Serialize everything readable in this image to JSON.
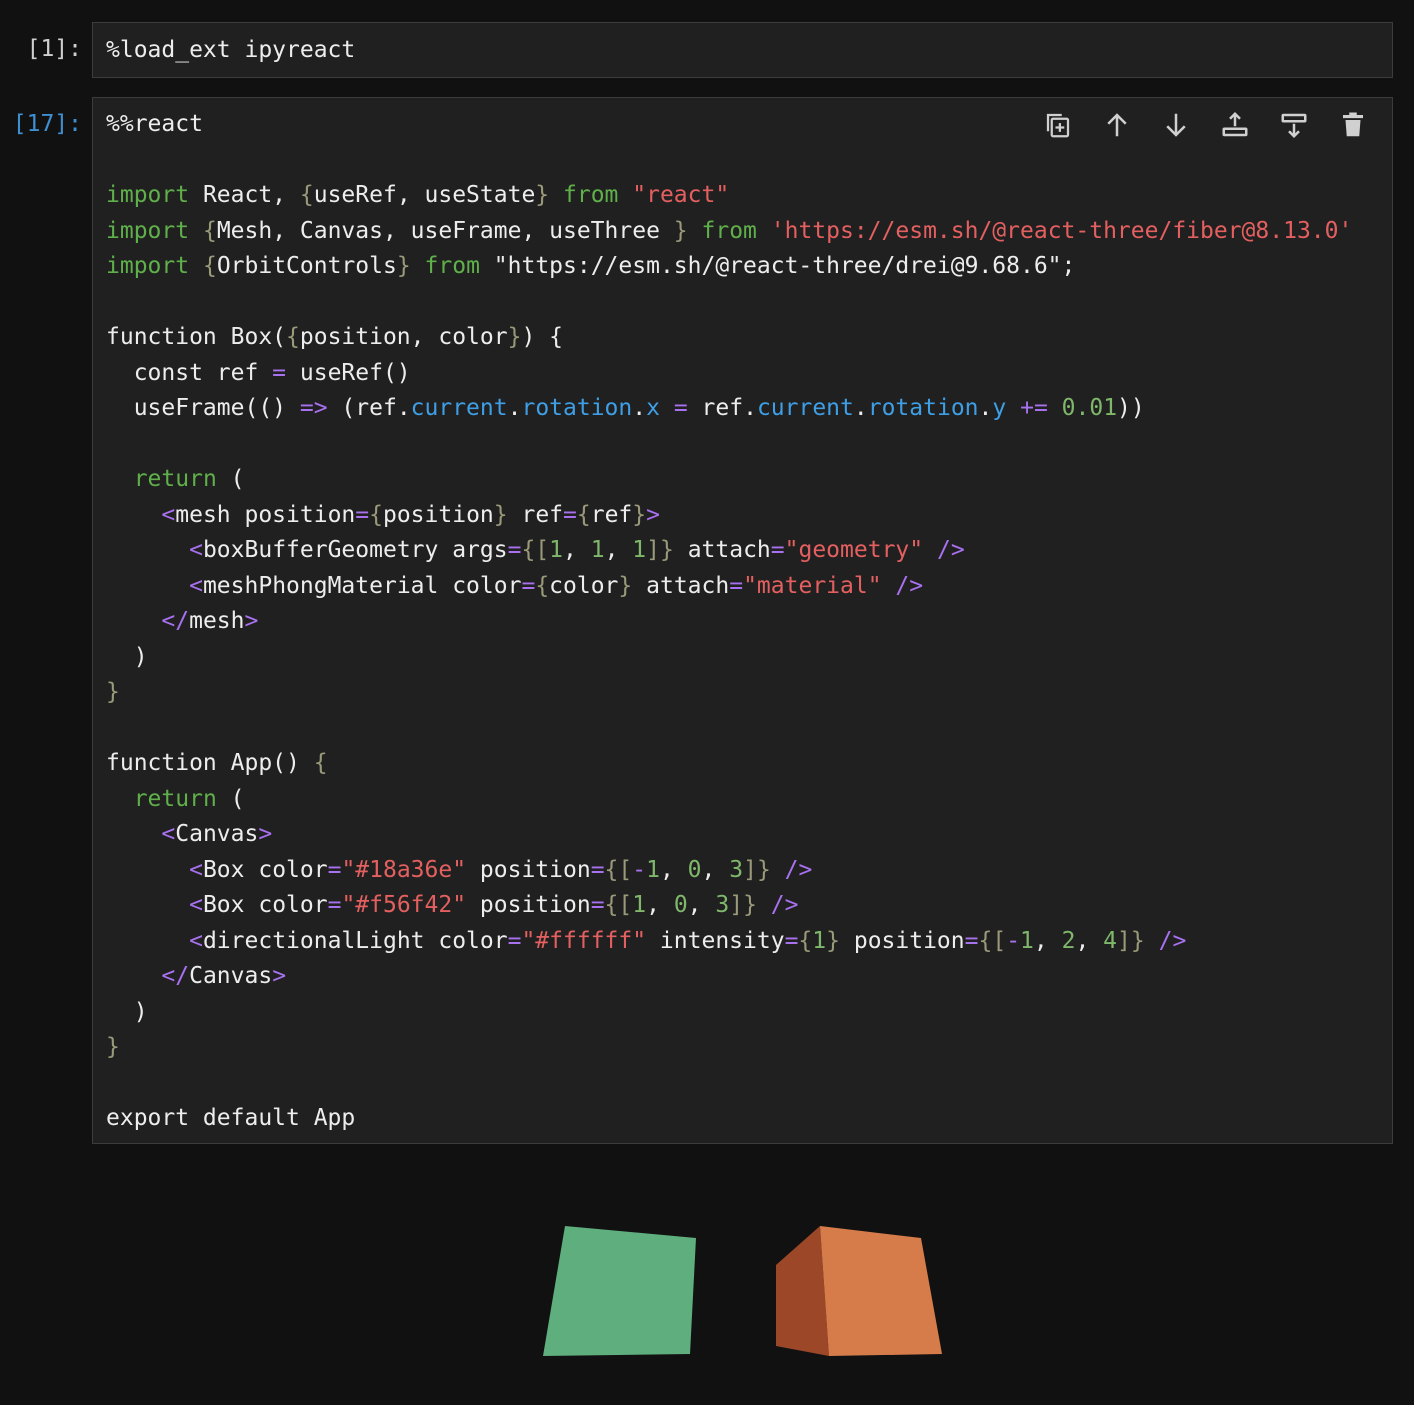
{
  "cells": [
    {
      "prompt": "[1]:",
      "lines": [
        [
          [
            "txt",
            "%load_ext ipyreact"
          ]
        ]
      ]
    },
    {
      "prompt": "[17]:",
      "lines": [
        [
          [
            "txt",
            "%%react"
          ]
        ],
        [],
        [
          [
            "kw",
            "import"
          ],
          [
            "txt",
            " React, "
          ],
          [
            "pun",
            "{"
          ],
          [
            "txt",
            "useRef, useState"
          ],
          [
            "pun",
            "}"
          ],
          [
            "txt",
            " "
          ],
          [
            "kw",
            "from"
          ],
          [
            "txt",
            " "
          ],
          [
            "str",
            "\"react\""
          ]
        ],
        [
          [
            "kw",
            "import"
          ],
          [
            "txt",
            " "
          ],
          [
            "pun",
            "{"
          ],
          [
            "txt",
            "Mesh, Canvas, useFrame, useThree "
          ],
          [
            "pun",
            "}"
          ],
          [
            "txt",
            " "
          ],
          [
            "kw",
            "from"
          ],
          [
            "txt",
            " "
          ],
          [
            "str",
            "'https://esm.sh/@react-three/fiber@8.13.0'"
          ]
        ],
        [
          [
            "kw",
            "import"
          ],
          [
            "txt",
            " "
          ],
          [
            "pun",
            "{"
          ],
          [
            "txt",
            "OrbitControls"
          ],
          [
            "pun",
            "}"
          ],
          [
            "txt",
            " "
          ],
          [
            "kw",
            "from"
          ],
          [
            "txt",
            " \"https://esm.sh/@react-three/drei@9.68.6\";"
          ]
        ],
        [],
        [
          [
            "txt",
            "function Box("
          ],
          [
            "pun",
            "{"
          ],
          [
            "txt",
            "position, color"
          ],
          [
            "pun",
            "}"
          ],
          [
            "txt",
            ") {"
          ]
        ],
        [
          [
            "txt",
            "  const ref "
          ],
          [
            "op",
            "="
          ],
          [
            "txt",
            " useRef()"
          ]
        ],
        [
          [
            "txt",
            "  useFrame(() "
          ],
          [
            "op",
            "=>"
          ],
          [
            "txt",
            " (ref."
          ],
          [
            "prop",
            "current"
          ],
          [
            "txt",
            "."
          ],
          [
            "prop",
            "rotation"
          ],
          [
            "txt",
            "."
          ],
          [
            "prop",
            "x"
          ],
          [
            "txt",
            " "
          ],
          [
            "op",
            "="
          ],
          [
            "txt",
            " ref."
          ],
          [
            "prop",
            "current"
          ],
          [
            "txt",
            "."
          ],
          [
            "prop",
            "rotation"
          ],
          [
            "txt",
            "."
          ],
          [
            "prop",
            "y"
          ],
          [
            "txt",
            " "
          ],
          [
            "op",
            "+="
          ],
          [
            "txt",
            " "
          ],
          [
            "num",
            "0.01"
          ],
          [
            "txt",
            "))"
          ]
        ],
        [],
        [
          [
            "txt",
            "  "
          ],
          [
            "kw",
            "return"
          ],
          [
            "txt",
            " ("
          ]
        ],
        [
          [
            "txt",
            "    "
          ],
          [
            "tag",
            "<"
          ],
          [
            "txt",
            "mesh position"
          ],
          [
            "op",
            "="
          ],
          [
            "pun",
            "{"
          ],
          [
            "txt",
            "position"
          ],
          [
            "pun",
            "}"
          ],
          [
            "txt",
            " ref"
          ],
          [
            "op",
            "="
          ],
          [
            "pun",
            "{"
          ],
          [
            "txt",
            "ref"
          ],
          [
            "pun",
            "}"
          ],
          [
            "tag",
            ">"
          ]
        ],
        [
          [
            "txt",
            "      "
          ],
          [
            "tag",
            "<"
          ],
          [
            "txt",
            "boxBufferGeometry args"
          ],
          [
            "op",
            "="
          ],
          [
            "pun",
            "{["
          ],
          [
            "num",
            "1"
          ],
          [
            "txt",
            ", "
          ],
          [
            "num",
            "1"
          ],
          [
            "txt",
            ", "
          ],
          [
            "num",
            "1"
          ],
          [
            "pun",
            "]}"
          ],
          [
            "txt",
            " attach"
          ],
          [
            "op",
            "="
          ],
          [
            "str",
            "\"geometry\""
          ],
          [
            "txt",
            " "
          ],
          [
            "tag",
            "/>"
          ]
        ],
        [
          [
            "txt",
            "      "
          ],
          [
            "tag",
            "<"
          ],
          [
            "txt",
            "meshPhongMaterial color"
          ],
          [
            "op",
            "="
          ],
          [
            "pun",
            "{"
          ],
          [
            "txt",
            "color"
          ],
          [
            "pun",
            "}"
          ],
          [
            "txt",
            " attach"
          ],
          [
            "op",
            "="
          ],
          [
            "str",
            "\"material\""
          ],
          [
            "txt",
            " "
          ],
          [
            "tag",
            "/>"
          ]
        ],
        [
          [
            "txt",
            "    "
          ],
          [
            "tag",
            "</"
          ],
          [
            "txt",
            "mesh"
          ],
          [
            "tag",
            ">"
          ]
        ],
        [
          [
            "txt",
            "  )"
          ]
        ],
        [
          [
            "pun",
            "}"
          ]
        ],
        [],
        [
          [
            "txt",
            "function App() "
          ],
          [
            "pun",
            "{"
          ]
        ],
        [
          [
            "txt",
            "  "
          ],
          [
            "kw",
            "return"
          ],
          [
            "txt",
            " ("
          ]
        ],
        [
          [
            "txt",
            "    "
          ],
          [
            "tag",
            "<"
          ],
          [
            "txt",
            "Canvas"
          ],
          [
            "tag",
            ">"
          ]
        ],
        [
          [
            "txt",
            "      "
          ],
          [
            "tag",
            "<"
          ],
          [
            "txt",
            "Box color"
          ],
          [
            "op",
            "="
          ],
          [
            "str",
            "\"#18a36e\""
          ],
          [
            "txt",
            " position"
          ],
          [
            "op",
            "="
          ],
          [
            "pun",
            "{["
          ],
          [
            "op",
            "-"
          ],
          [
            "num",
            "1"
          ],
          [
            "txt",
            ", "
          ],
          [
            "num",
            "0"
          ],
          [
            "txt",
            ", "
          ],
          [
            "num",
            "3"
          ],
          [
            "pun",
            "]}"
          ],
          [
            "txt",
            " "
          ],
          [
            "tag",
            "/>"
          ]
        ],
        [
          [
            "txt",
            "      "
          ],
          [
            "tag",
            "<"
          ],
          [
            "txt",
            "Box color"
          ],
          [
            "op",
            "="
          ],
          [
            "str",
            "\"#f56f42\""
          ],
          [
            "txt",
            " position"
          ],
          [
            "op",
            "="
          ],
          [
            "pun",
            "{["
          ],
          [
            "num",
            "1"
          ],
          [
            "txt",
            ", "
          ],
          [
            "num",
            "0"
          ],
          [
            "txt",
            ", "
          ],
          [
            "num",
            "3"
          ],
          [
            "pun",
            "]}"
          ],
          [
            "txt",
            " "
          ],
          [
            "tag",
            "/>"
          ]
        ],
        [
          [
            "txt",
            "      "
          ],
          [
            "tag",
            "<"
          ],
          [
            "txt",
            "directionalLight color"
          ],
          [
            "op",
            "="
          ],
          [
            "str",
            "\"#ffffff\""
          ],
          [
            "txt",
            " intensity"
          ],
          [
            "op",
            "="
          ],
          [
            "pun",
            "{"
          ],
          [
            "num",
            "1"
          ],
          [
            "pun",
            "}"
          ],
          [
            "txt",
            " position"
          ],
          [
            "op",
            "="
          ],
          [
            "pun",
            "{["
          ],
          [
            "op",
            "-"
          ],
          [
            "num",
            "1"
          ],
          [
            "txt",
            ", "
          ],
          [
            "num",
            "2"
          ],
          [
            "txt",
            ", "
          ],
          [
            "num",
            "4"
          ],
          [
            "pun",
            "]}"
          ],
          [
            "txt",
            " "
          ],
          [
            "tag",
            "/>"
          ]
        ],
        [
          [
            "txt",
            "    "
          ],
          [
            "tag",
            "</"
          ],
          [
            "txt",
            "Canvas"
          ],
          [
            "tag",
            ">"
          ]
        ],
        [
          [
            "txt",
            "  )"
          ]
        ],
        [
          [
            "pun",
            "}"
          ]
        ],
        [],
        [
          [
            "txt",
            "export default App"
          ]
        ]
      ]
    }
  ],
  "toolbar": {
    "buttons": [
      {
        "name": "duplicate-cell-button",
        "icon": "duplicate-icon"
      },
      {
        "name": "move-up-button",
        "icon": "arrow-up-icon"
      },
      {
        "name": "move-down-button",
        "icon": "arrow-down-icon"
      },
      {
        "name": "insert-above-button",
        "icon": "insert-above-icon"
      },
      {
        "name": "insert-below-button",
        "icon": "insert-below-icon"
      },
      {
        "name": "delete-cell-button",
        "icon": "trash-icon"
      }
    ]
  },
  "output": {
    "boxes": [
      {
        "name": "green-box",
        "color": "#5fae7e"
      },
      {
        "name": "orange-box",
        "color": "#d57c4a",
        "side_color": "#9c4828"
      }
    ]
  },
  "colors": {
    "background": "#111111",
    "cell_background": "#202020",
    "active_prompt": "#3f8fd1",
    "keyword": "#5fb04a",
    "string": "#e46060",
    "property": "#3e9fe6",
    "number": "#7fb76b",
    "operator": "#a871f0"
  }
}
